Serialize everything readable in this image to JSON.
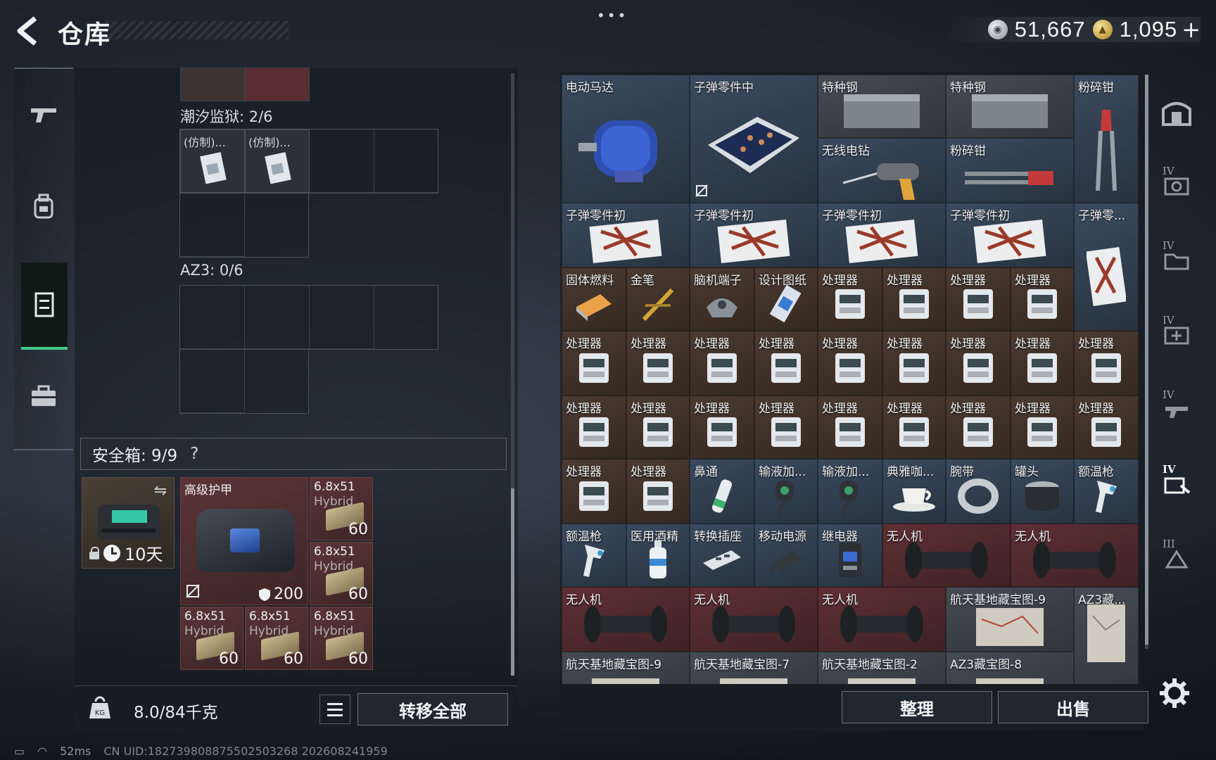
{
  "header": {
    "title": "仓库",
    "more": "•••"
  },
  "currency": {
    "silver": "51,667",
    "gold": "1,095",
    "plus": "+"
  },
  "left": {
    "prison_label": "潮汐监狱: 2/6",
    "copy_label": "(仿制)...",
    "az3_label": "AZ3: 0/6",
    "safe": {
      "title": "安全箱: 9/9",
      "help": "?",
      "days": "10天"
    },
    "safe_items": {
      "armor_name": "高级护甲",
      "armor_dur": "200",
      "ammo_name": "6.8x51",
      "ammo_sub": "Hybrid",
      "ammo_qty": "60"
    },
    "weight": "8.0/84千克",
    "transfer_all": "转移全部"
  },
  "right": {
    "items": [
      {
        "n": "电动马达"
      },
      {
        "n": "子弹零件中"
      },
      {
        "n": "特种钢"
      },
      {
        "n": "特种钢"
      },
      {
        "n": "粉碎钳"
      },
      {
        "n": "无线电钻"
      },
      {
        "n": "粉碎钳"
      },
      {
        "n": "子弹零件初"
      },
      {
        "n": "子弹零件初"
      },
      {
        "n": "子弹零件初"
      },
      {
        "n": "子弹零件初"
      },
      {
        "n": "子弹零..."
      },
      {
        "n": "固体燃料"
      },
      {
        "n": "金笔"
      },
      {
        "n": "脑机端子"
      },
      {
        "n": "设计图纸"
      },
      {
        "n": "处理器"
      },
      {
        "n": "鼻通"
      },
      {
        "n": "输液加..."
      },
      {
        "n": "输液加..."
      },
      {
        "n": "典雅咖..."
      },
      {
        "n": "腕带"
      },
      {
        "n": "罐头"
      },
      {
        "n": "额温枪"
      },
      {
        "n": "额温枪"
      },
      {
        "n": "医用酒精"
      },
      {
        "n": "转换插座"
      },
      {
        "n": "移动电源"
      },
      {
        "n": "继电器"
      },
      {
        "n": "无人机"
      },
      {
        "n": "航天基地藏宝图-9"
      },
      {
        "n": "AZ3藏..."
      },
      {
        "n": "航天基地藏宝图-9"
      },
      {
        "n": "航天基地藏宝图-7"
      },
      {
        "n": "航天基地藏宝图-2"
      },
      {
        "n": "AZ3藏宝图-8"
      }
    ],
    "sort": "整理",
    "sell": "出售"
  },
  "right_tabs": [
    "IV",
    "IV",
    "IV",
    "IV",
    "IV",
    "III"
  ],
  "status": {
    "ping": "52ms",
    "uid": "CN UID:18273980887550250326​8 202608241959"
  }
}
